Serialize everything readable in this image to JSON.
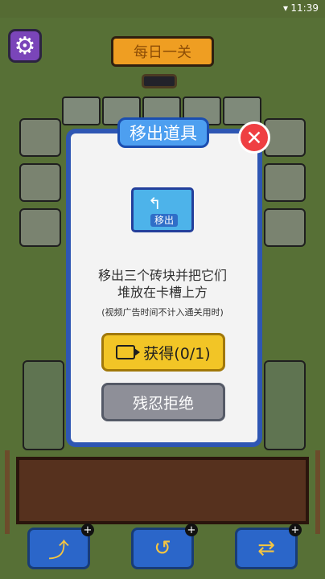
{
  "status": {
    "time": "11:39"
  },
  "header": {
    "daily_label": "每日一关"
  },
  "modal": {
    "title": "移出道具",
    "card_label": "移出",
    "line1": "移出三个砖块并把它们",
    "line2": "堆放在卡槽上方",
    "note": "(视频广告时间不计入通关用时)",
    "get_button": "获得(0/1)",
    "refuse_button": "残忍拒绝"
  },
  "icons": {
    "settings": "gear-icon",
    "close": "close-icon",
    "video": "video-icon",
    "move": "move-icon",
    "undo": "undo-icon",
    "shuffle": "shuffle-icon"
  }
}
